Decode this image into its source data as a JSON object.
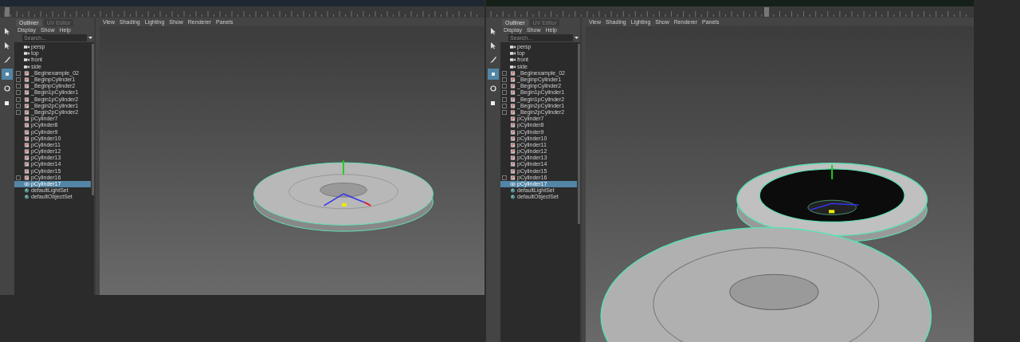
{
  "windows": [
    {
      "outliner": {
        "tabs": [
          {
            "label": "Outliner",
            "selected": true
          },
          {
            "label": "UV Editor",
            "selected": false
          }
        ],
        "menu": [
          "Display",
          "Show",
          "Help"
        ],
        "search": {
          "placeholder": "Search..."
        },
        "items": [
          {
            "label": "persp",
            "kind": "camera",
            "selected": false
          },
          {
            "label": "top",
            "kind": "camera",
            "selected": false
          },
          {
            "label": "front",
            "kind": "camera",
            "selected": false
          },
          {
            "label": "side",
            "kind": "camera",
            "selected": false
          },
          {
            "label": "_Beginexample_02",
            "kind": "group",
            "selected": false
          },
          {
            "label": "_BeginpCylinder1",
            "kind": "group",
            "selected": false
          },
          {
            "label": "_BeginpCylinder2",
            "kind": "group",
            "selected": false
          },
          {
            "label": "_Begin1pCylinder1",
            "kind": "group",
            "selected": false
          },
          {
            "label": "_Begin1pCylinder2",
            "kind": "group",
            "selected": false
          },
          {
            "label": "_Begin2pCylinder1",
            "kind": "group",
            "selected": false
          },
          {
            "label": "_Begin2pCylinder2",
            "kind": "group",
            "selected": false
          },
          {
            "label": "pCylinder7",
            "kind": "mesh",
            "selected": false
          },
          {
            "label": "pCylinder8",
            "kind": "mesh",
            "selected": false
          },
          {
            "label": "pCylinder9",
            "kind": "mesh",
            "selected": false
          },
          {
            "label": "pCylinder10",
            "kind": "mesh",
            "selected": false
          },
          {
            "label": "pCylinder11",
            "kind": "mesh",
            "selected": false
          },
          {
            "label": "pCylinder12",
            "kind": "mesh",
            "selected": false
          },
          {
            "label": "pCylinder13",
            "kind": "mesh",
            "selected": false
          },
          {
            "label": "pCylinder14",
            "kind": "mesh",
            "selected": false
          },
          {
            "label": "pCylinder15",
            "kind": "mesh",
            "selected": false
          },
          {
            "label": "pCylinder16",
            "kind": "group",
            "selected": false
          },
          {
            "label": "pCylinder17",
            "kind": "selmesh",
            "selected": true
          },
          {
            "label": "defaultLightSet",
            "kind": "set",
            "selected": false
          },
          {
            "label": "defaultObjectSet",
            "kind": "set",
            "selected": false
          }
        ]
      },
      "tools": [
        {
          "kind": "select",
          "selected": false
        },
        {
          "kind": "lasso",
          "selected": false
        },
        {
          "kind": "paint",
          "selected": false
        },
        {
          "kind": "move",
          "selected": true
        },
        {
          "kind": "rotate",
          "selected": false
        },
        {
          "kind": "scale",
          "selected": false
        }
      ],
      "timeline": {
        "level": 0.01
      },
      "viewport_menu": [
        "View",
        "Shading",
        "Lighting",
        "Show",
        "Renderer",
        "Panels"
      ]
    },
    {
      "outliner": {
        "tabs": [
          {
            "label": "Outliner",
            "selected": true
          },
          {
            "label": "UV Editor",
            "selected": false
          }
        ],
        "menu": [
          "Display",
          "Show",
          "Help"
        ],
        "search": {
          "placeholder": "Search..."
        },
        "items": [
          {
            "label": "persp",
            "kind": "camera",
            "selected": false
          },
          {
            "label": "top",
            "kind": "camera",
            "selected": false
          },
          {
            "label": "front",
            "kind": "camera",
            "selected": false
          },
          {
            "label": "side",
            "kind": "camera",
            "selected": false
          },
          {
            "label": "_Beginexample_02",
            "kind": "group",
            "selected": false
          },
          {
            "label": "_BeginpCylinder1",
            "kind": "group",
            "selected": false
          },
          {
            "label": "_BeginpCylinder2",
            "kind": "group",
            "selected": false
          },
          {
            "label": "_Begin1pCylinder1",
            "kind": "group",
            "selected": false
          },
          {
            "label": "_Begin1pCylinder2",
            "kind": "group",
            "selected": false
          },
          {
            "label": "_Begin2pCylinder1",
            "kind": "group",
            "selected": false
          },
          {
            "label": "_Begin2pCylinder2",
            "kind": "group",
            "selected": false
          },
          {
            "label": "pCylinder7",
            "kind": "mesh",
            "selected": false
          },
          {
            "label": "pCylinder8",
            "kind": "mesh",
            "selected": false
          },
          {
            "label": "pCylinder9",
            "kind": "mesh",
            "selected": false
          },
          {
            "label": "pCylinder10",
            "kind": "mesh",
            "selected": false
          },
          {
            "label": "pCylinder11",
            "kind": "mesh",
            "selected": false
          },
          {
            "label": "pCylinder12",
            "kind": "mesh",
            "selected": false
          },
          {
            "label": "pCylinder13",
            "kind": "mesh",
            "selected": false
          },
          {
            "label": "pCylinder14",
            "kind": "mesh",
            "selected": false
          },
          {
            "label": "pCylinder15",
            "kind": "mesh",
            "selected": false
          },
          {
            "label": "pCylinder16",
            "kind": "group",
            "selected": false
          },
          {
            "label": "pCylinder17",
            "kind": "selmesh",
            "selected": true
          },
          {
            "label": "defaultLightSet",
            "kind": "set",
            "selected": false
          },
          {
            "label": "defaultObjectSet",
            "kind": "set",
            "selected": false
          }
        ]
      },
      "tools": [
        {
          "kind": "select",
          "selected": false
        },
        {
          "kind": "lasso",
          "selected": false
        },
        {
          "kind": "paint",
          "selected": false
        },
        {
          "kind": "move",
          "selected": true
        },
        {
          "kind": "rotate",
          "selected": false
        },
        {
          "kind": "scale",
          "selected": false
        }
      ],
      "timeline": {
        "level": 0.57
      },
      "viewport_menu": [
        "View",
        "Shading",
        "Lighting",
        "Show",
        "Renderer",
        "Panels"
      ]
    }
  ]
}
